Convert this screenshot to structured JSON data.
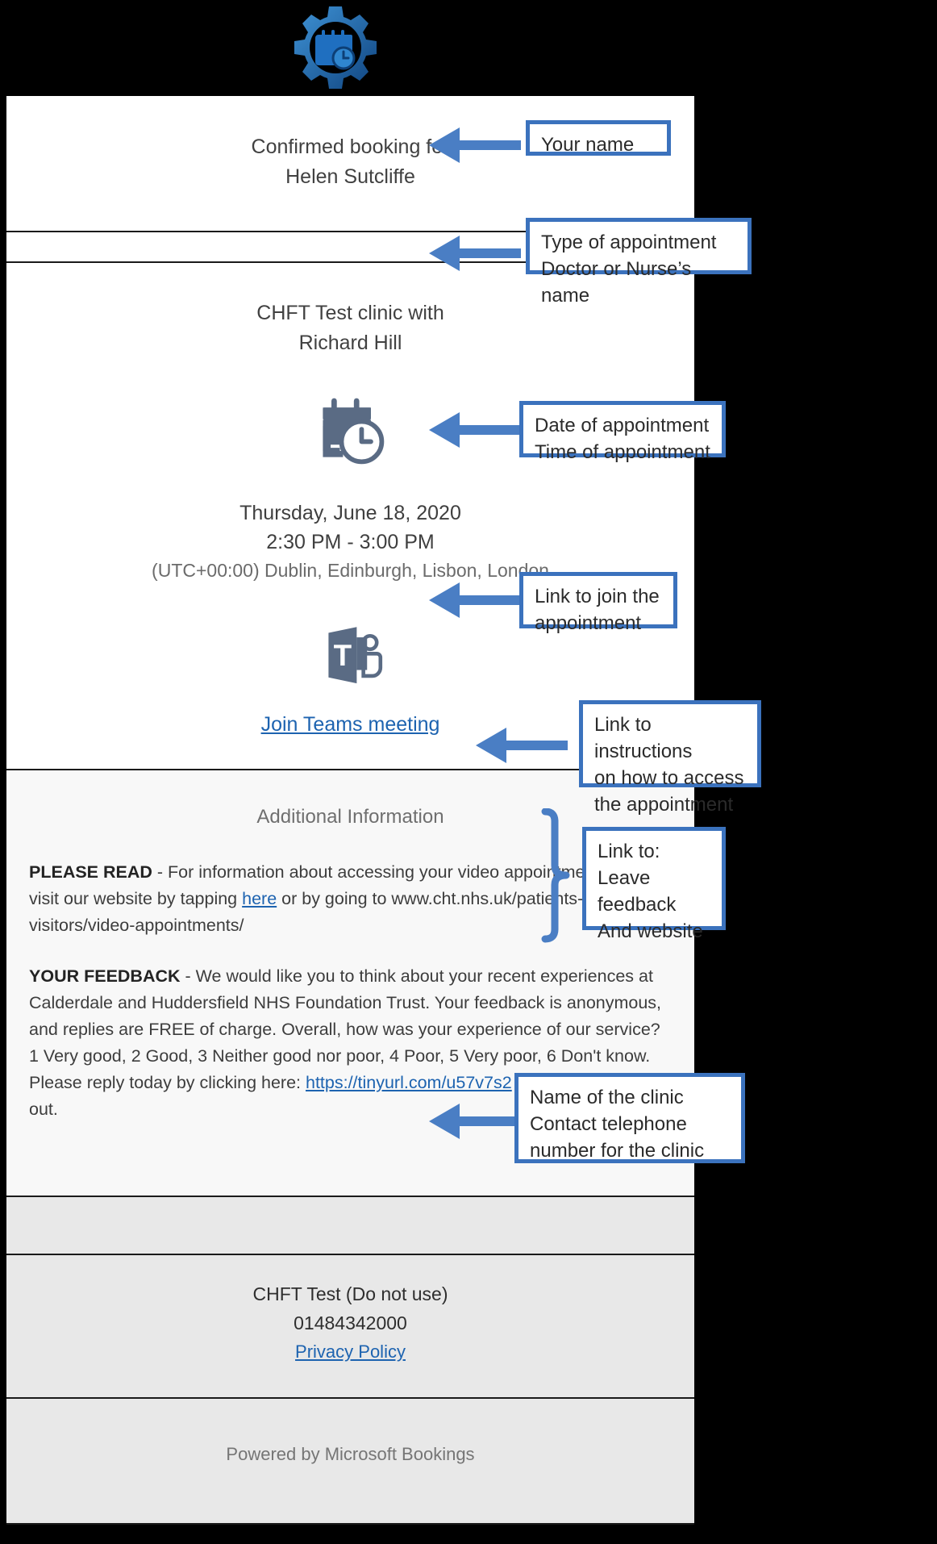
{
  "brand": {
    "logo_icon": "bookings-gear-calendar-icon",
    "accent": "#3b72bd",
    "link_color": "#1d63b0"
  },
  "email": {
    "header": {
      "line1": "Confirmed booking for",
      "line2": "Helen Sutcliffe"
    },
    "appointment": {
      "service_line": "CHFT Test clinic with",
      "staff_line": "Richard Hill",
      "calendar_icon": "calendar-clock-icon",
      "date": "Thursday, June 18, 2020",
      "time": "2:30 PM - 3:00 PM",
      "timezone": "(UTC+00:00) Dublin, Edinburgh, Lisbon, London",
      "teams_icon": "microsoft-teams-icon",
      "join_link_label": "Join Teams meeting"
    },
    "additional_information": {
      "title": "Additional Information",
      "please_read": {
        "label": "PLEASE READ",
        "text_before_link": " - For information about accessing your video appointment please visit our website by tapping ",
        "link_label": "here",
        "text_after_link": " or by going to www.cht.nhs.uk/patients-visitors/video-appointments/"
      },
      "your_feedback": {
        "label": "YOUR FEEDBACK",
        "text_before_link": " - We would like you to think about your recent experiences at Calderdale and Huddersfield NHS Foundation Trust. Your feedback is anonymous, and replies are FREE of charge. Overall, how was your experience of our service? 1 Very good, 2 Good, 3 Neither good nor poor, 4 Poor, 5 Very poor, 6 Don't know. Please reply today by clicking here: ",
        "link_label": "https://tinyurl.com/u57v7s2",
        "text_after_link": " . Reply STOP to opt out."
      }
    },
    "clinic": {
      "name": "CHFT Test (Do not use)",
      "phone": "01484342000",
      "privacy_policy_label": "Privacy Policy"
    },
    "footer": {
      "powered_by": "Powered by Microsoft Bookings"
    }
  },
  "annotations": [
    {
      "id": "your-name",
      "lines": [
        "Your name"
      ]
    },
    {
      "id": "appointment-type",
      "lines": [
        "Type of appointment",
        "Doctor or Nurse’s name"
      ]
    },
    {
      "id": "date-time",
      "lines": [
        "Date of appointment",
        "Time of appointment"
      ]
    },
    {
      "id": "join-link",
      "lines": [
        "Link to join the",
        "appointment"
      ]
    },
    {
      "id": "instructions",
      "lines": [
        "Link to instructions",
        "on how to access",
        "the appointment"
      ]
    },
    {
      "id": "feedback",
      "lines": [
        "Link to:",
        "Leave",
        "feedback",
        "And website"
      ]
    },
    {
      "id": "clinic-contact",
      "lines": [
        "Name of the clinic",
        "Contact telephone",
        "number for the clinic"
      ]
    }
  ]
}
